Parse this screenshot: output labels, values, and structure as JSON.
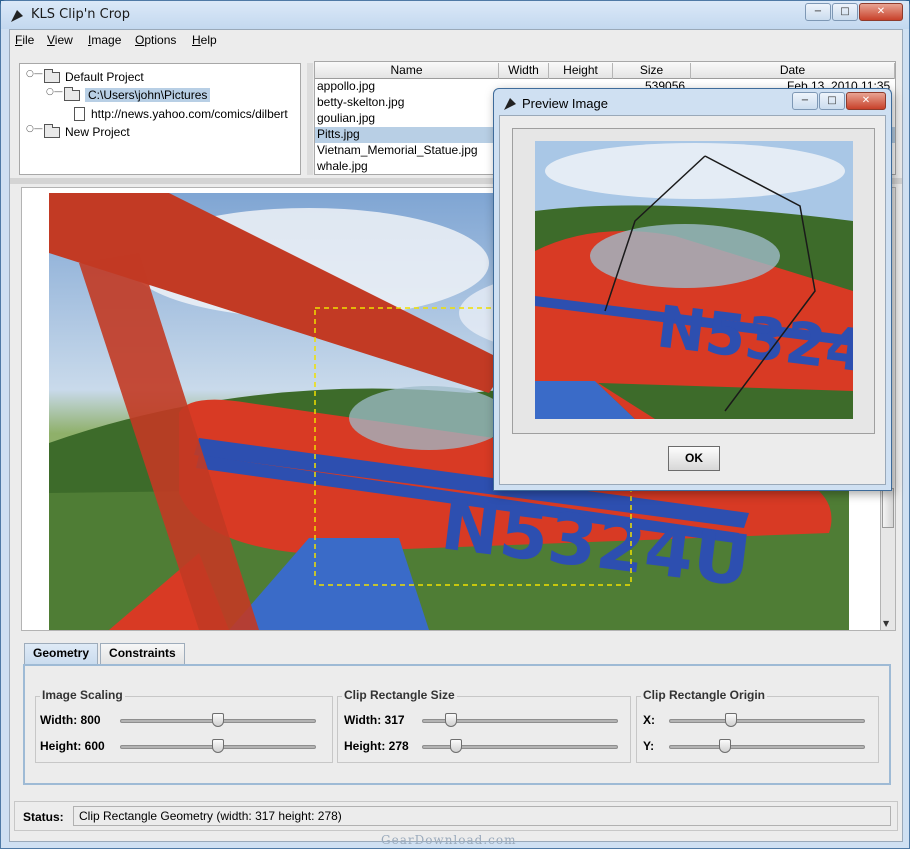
{
  "window": {
    "title": "KLS Clip'n Crop",
    "controls": {
      "minimize": "−",
      "maximize": "□",
      "close": "✕"
    }
  },
  "menu": {
    "items": [
      {
        "key": "F",
        "rest": "ile"
      },
      {
        "key": "V",
        "rest": "iew"
      },
      {
        "key": "I",
        "rest": "mage"
      },
      {
        "key": "O",
        "rest": "ptions"
      },
      {
        "key": "H",
        "rest": "elp"
      }
    ]
  },
  "tree": {
    "nodes": [
      {
        "label": "Default Project",
        "icon": "folder-icon"
      },
      {
        "label": "C:\\Users\\john\\Pictures",
        "icon": "folder-icon",
        "selected": true
      },
      {
        "label": "http://news.yahoo.com/comics/dilbert",
        "icon": "file-icon"
      },
      {
        "label": "New Project",
        "icon": "folder-icon"
      }
    ]
  },
  "file_table": {
    "columns": [
      "Name",
      "Width",
      "Height",
      "Size",
      "Date"
    ],
    "rows": [
      {
        "name": "appollo.jpg",
        "size": "539056",
        "date": "Feb 13, 2010 11:35"
      },
      {
        "name": "betty-skelton.jpg"
      },
      {
        "name": "goulian.jpg"
      },
      {
        "name": "Pitts.jpg",
        "selected": true
      },
      {
        "name": "Vietnam_Memorial_Statue.jpg"
      },
      {
        "name": "whale.jpg"
      }
    ]
  },
  "tabs": {
    "geometry": "Geometry",
    "constraints": "Constraints"
  },
  "geometry": {
    "image_scaling": {
      "title": "Image Scaling",
      "width_label": "Width: 800",
      "height_label": "Height: 600",
      "width_position": 0.5,
      "height_position": 0.5
    },
    "clip_size": {
      "title": "Clip Rectangle Size",
      "width_label": "Width: 317",
      "height_label": "Height: 278",
      "width_position": 0.12,
      "height_position": 0.15
    },
    "clip_origin": {
      "title": "Clip Rectangle Origin",
      "x_label": "X:",
      "y_label": "Y:",
      "x_position": 0.3,
      "y_position": 0.27
    }
  },
  "status": {
    "label": "Status:",
    "text": "Clip Rectangle Geometry (width: 317 height: 278)"
  },
  "dialog": {
    "title": "Preview Image",
    "ok_label": "OK"
  },
  "watermark": "GearDownload.com",
  "colors": {
    "titlebar": "#c3d8ef",
    "selection": "#b8cfe5",
    "plane_red": "#d83a24",
    "sky": "#a9c7e6"
  }
}
